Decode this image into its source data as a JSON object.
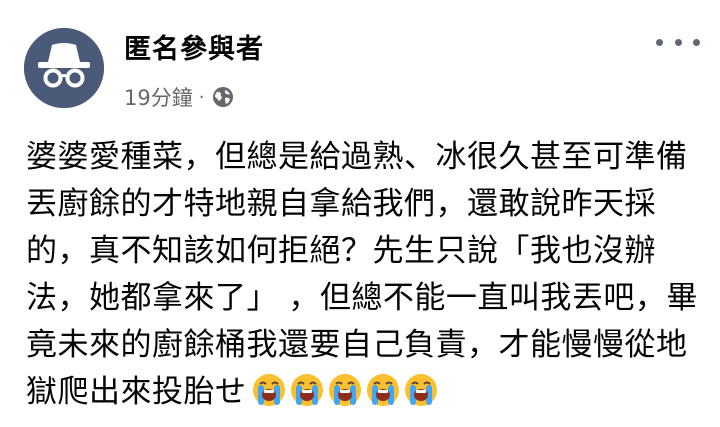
{
  "post": {
    "author_name": "匿名參與者",
    "timestamp": "19分鐘",
    "separator": "·",
    "privacy_icon": "globe-icon",
    "more_icon": "more-options-icon",
    "text_lines": [
      "婆婆愛種菜，但總是給過熟、冰很久甚至可準備",
      "丟廚餘的才特地親自拿給我們，還敢說昨天採",
      "的，真不知該如何拒絕？先生只說「我也沒辦",
      "法，她都拿來了」 ，但總不能一直叫我丟吧，畢",
      "竟未來的廚餘桶我還要自己負責，才能慢慢從地",
      "獄爬出來投胎せ"
    ],
    "emojis": [
      "loudly-crying-face-emoji",
      "loudly-crying-face-emoji",
      "loudly-crying-face-emoji",
      "loudly-crying-face-emoji",
      "loudly-crying-face-emoji"
    ]
  },
  "colors": {
    "avatar_bg": "#4a5a78",
    "secondary_text": "#65676b",
    "emoji_face": "#fbc02d",
    "emoji_tears": "#42a5f5"
  }
}
